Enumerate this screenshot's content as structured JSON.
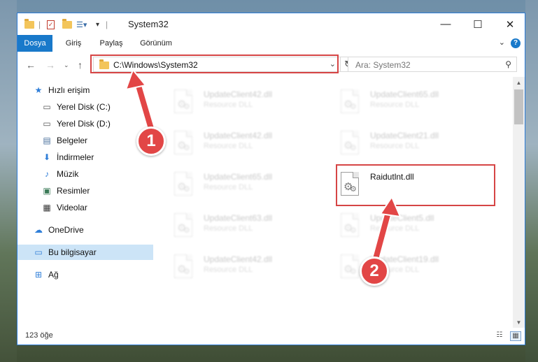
{
  "window": {
    "title": "System32"
  },
  "ribbon": {
    "tabs": [
      "Dosya",
      "Giriş",
      "Paylaş",
      "Görünüm"
    ]
  },
  "address": {
    "path": "C:\\Windows\\System32"
  },
  "search": {
    "placeholder": "Ara: System32"
  },
  "sidebar": {
    "items": [
      {
        "label": "Hızlı erişim"
      },
      {
        "label": "Yerel Disk (C:)"
      },
      {
        "label": "Yerel Disk (D:)"
      },
      {
        "label": "Belgeler"
      },
      {
        "label": "İndirmeler"
      },
      {
        "label": "Müzik"
      },
      {
        "label": "Resimler"
      },
      {
        "label": "Videolar"
      },
      {
        "label": "OneDrive"
      },
      {
        "label": "Bu bilgisayar"
      },
      {
        "label": "Ağ"
      }
    ]
  },
  "files": [
    {
      "name": "UpdateClient42.dll",
      "type": "Resource DLL"
    },
    {
      "name": "UpdateClient65.dll",
      "type": "Resource DLL"
    },
    {
      "name": "UpdateClient42.dll",
      "type": "Resource DLL"
    },
    {
      "name": "UpdateClient21.dll",
      "type": "Resource DLL"
    },
    {
      "name": "UpdateClient65.dll",
      "type": "Resource DLL"
    },
    {
      "name": "Raidutlnt.dll",
      "type": ""
    },
    {
      "name": "UpdateClient63.dll",
      "type": "Resource DLL"
    },
    {
      "name": "UpdateClient5.dll",
      "type": "Resource DLL"
    },
    {
      "name": "UpdateClient42.dll",
      "type": "Resource DLL"
    },
    {
      "name": "UpdateClient19.dll",
      "type": "Resource DLL"
    }
  ],
  "status": {
    "count": "123 öğe"
  },
  "callouts": [
    "1",
    "2"
  ],
  "colors": {
    "accent": "#1979ca",
    "highlight": "#d64545",
    "selection": "#cce4f7"
  }
}
